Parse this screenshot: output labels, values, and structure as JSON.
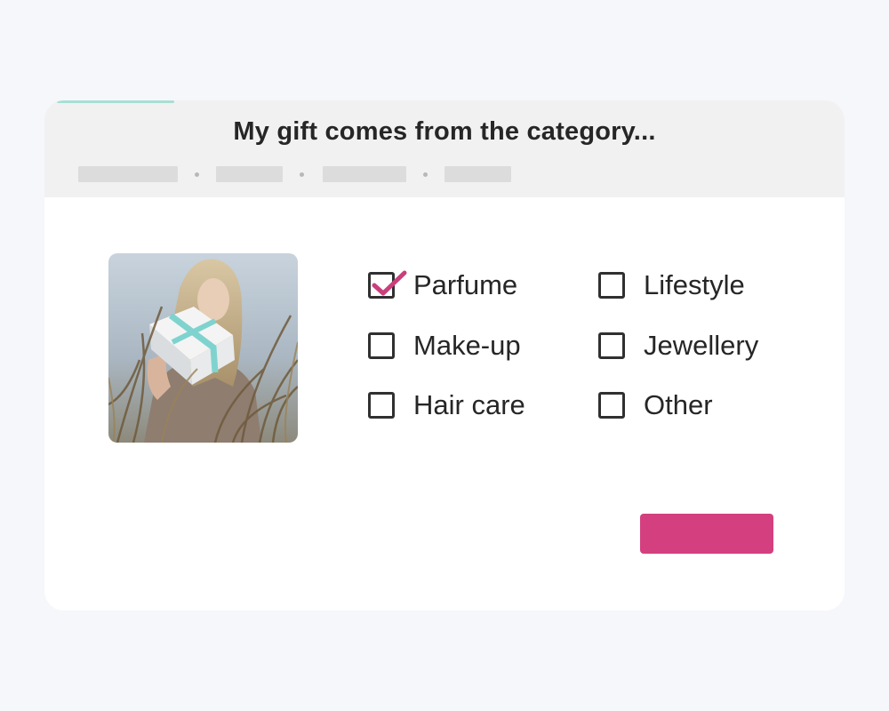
{
  "question": {
    "title": "My gift comes from the category...",
    "progress_fraction": 0.15
  },
  "options": [
    {
      "label": "Parfume",
      "checked": true
    },
    {
      "label": "Lifestyle",
      "checked": false
    },
    {
      "label": "Make-up",
      "checked": false
    },
    {
      "label": "Jewellery",
      "checked": false
    },
    {
      "label": "Hair care",
      "checked": false
    },
    {
      "label": "Other",
      "checked": false
    }
  ],
  "photo": {
    "icon": "photo-woman-with-gift"
  },
  "submit": {
    "label": ""
  },
  "colors": {
    "accent": "#d43f7f",
    "progress": "#a8dfd4",
    "card": "#ffffff",
    "header": "#f1f1f1",
    "background": "#f6f7fb",
    "checkmark": "#c93f7c"
  }
}
